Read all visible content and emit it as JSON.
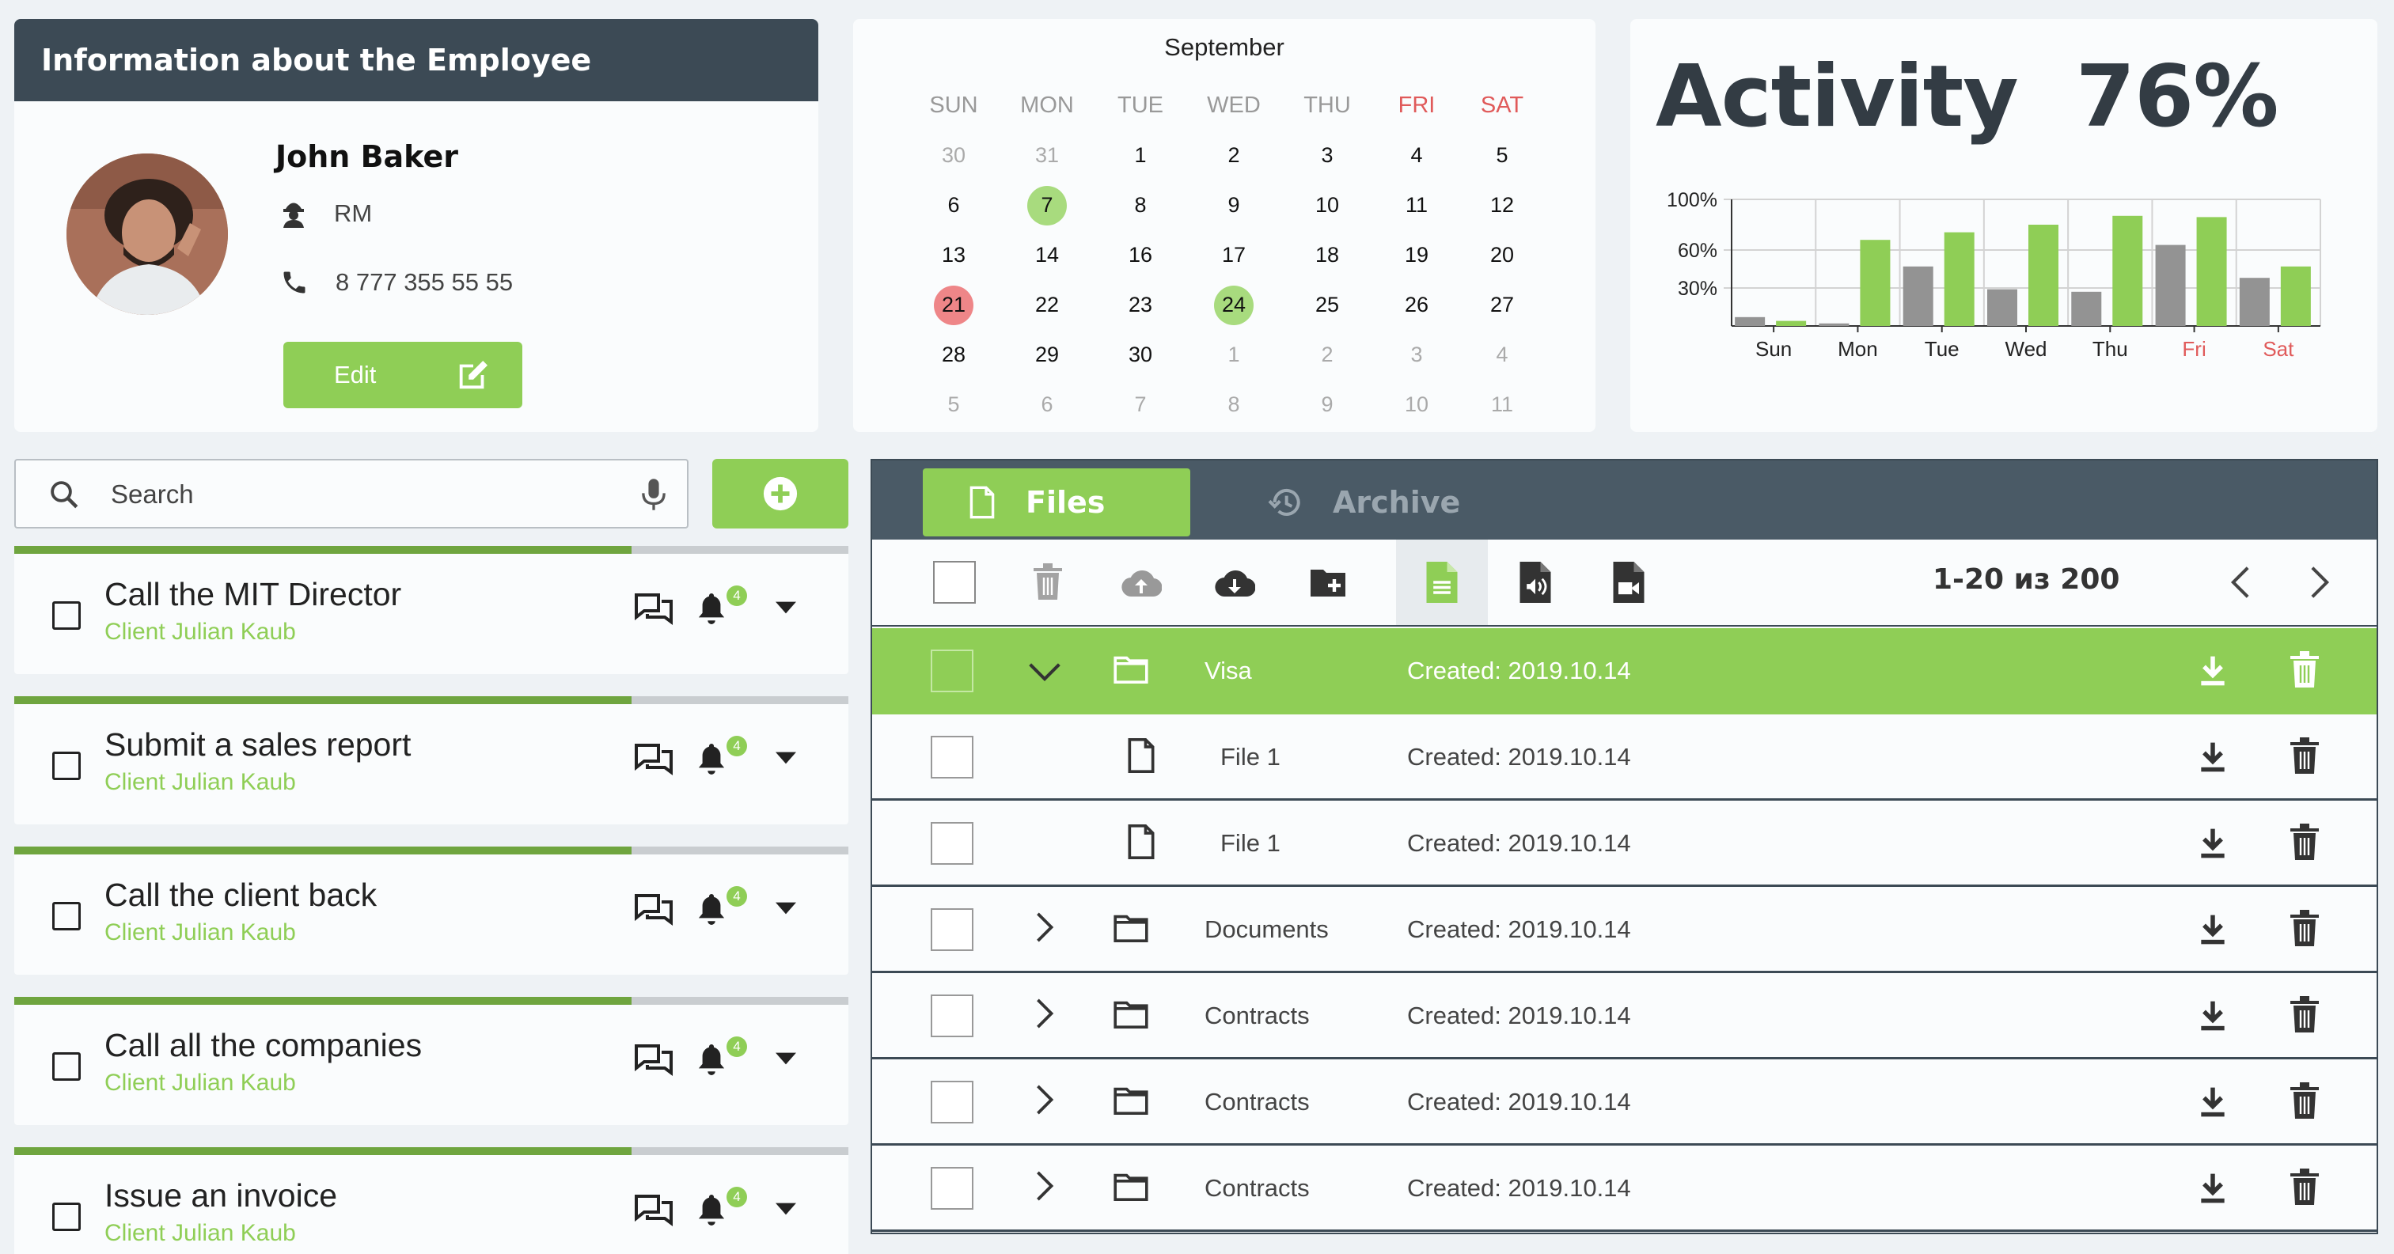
{
  "employee": {
    "header": "Information about the Employee",
    "name": "John Baker",
    "role": "RM",
    "phone": "8 777 355 55 55",
    "edit_label": "Edit"
  },
  "calendar": {
    "month": "September",
    "weekdays": [
      {
        "label": "SUN",
        "weekend": false
      },
      {
        "label": "MON",
        "weekend": false
      },
      {
        "label": "TUE",
        "weekend": false
      },
      {
        "label": "WED",
        "weekend": false
      },
      {
        "label": "THU",
        "weekend": false
      },
      {
        "label": "FRI",
        "weekend": true
      },
      {
        "label": "SAT",
        "weekend": true
      }
    ],
    "weeks": [
      [
        {
          "d": "30",
          "m": true
        },
        {
          "d": "31",
          "m": true
        },
        {
          "d": "1"
        },
        {
          "d": "2"
        },
        {
          "d": "3"
        },
        {
          "d": "4"
        },
        {
          "d": "5"
        }
      ],
      [
        {
          "d": "6"
        },
        {
          "d": "7",
          "hl": "green"
        },
        {
          "d": "8"
        },
        {
          "d": "9"
        },
        {
          "d": "10"
        },
        {
          "d": "11"
        },
        {
          "d": "12"
        }
      ],
      [
        {
          "d": "13"
        },
        {
          "d": "14"
        },
        {
          "d": "16"
        },
        {
          "d": "17"
        },
        {
          "d": "18"
        },
        {
          "d": "19"
        },
        {
          "d": "20"
        }
      ],
      [
        {
          "d": "21",
          "hl": "red"
        },
        {
          "d": "22"
        },
        {
          "d": "23"
        },
        {
          "d": "24",
          "hl": "green"
        },
        {
          "d": "25"
        },
        {
          "d": "26"
        },
        {
          "d": "27"
        }
      ],
      [
        {
          "d": "28"
        },
        {
          "d": "29"
        },
        {
          "d": "30"
        },
        {
          "d": "1",
          "m": true
        },
        {
          "d": "2",
          "m": true
        },
        {
          "d": "3",
          "m": true
        },
        {
          "d": "4",
          "m": true
        }
      ],
      [
        {
          "d": "5",
          "m": true
        },
        {
          "d": "6",
          "m": true
        },
        {
          "d": "7",
          "m": true
        },
        {
          "d": "8",
          "m": true
        },
        {
          "d": "9",
          "m": true
        },
        {
          "d": "10",
          "m": true
        },
        {
          "d": "11",
          "m": true
        }
      ]
    ]
  },
  "activity": {
    "title": "Activity  76%"
  },
  "chart_data": {
    "type": "bar",
    "categories": [
      "Sun",
      "Mon",
      "Tue",
      "Wed",
      "Thu",
      "Fri",
      "Sat"
    ],
    "highlight_categories": [
      "Fri",
      "Sat"
    ],
    "highlight_color": "#e05a5a",
    "y_ticks": [
      "100%",
      "60%",
      "30%"
    ],
    "y_tick_values": [
      100,
      60,
      30
    ],
    "ylim": [
      0,
      100
    ],
    "grid": true,
    "series": [
      {
        "color": "#939393",
        "values": [
          7,
          2,
          47,
          29,
          27,
          64,
          38
        ]
      },
      {
        "color": "#8fce56",
        "values": [
          4,
          68,
          74,
          80,
          87,
          86,
          47
        ]
      }
    ]
  },
  "search": {
    "placeholder": "Search"
  },
  "tasks": [
    {
      "title": "Call the MIT Director",
      "client": "Client Julian Kaub",
      "badge": "4",
      "progress": 0.74
    },
    {
      "title": "Submit a sales report",
      "client": "Client Julian Kaub",
      "badge": "4",
      "progress": 0.74
    },
    {
      "title": "Call the client back",
      "client": "Client Julian Kaub",
      "badge": "4",
      "progress": 0.74
    },
    {
      "title": "Call all the companies",
      "client": "Client Julian Kaub",
      "badge": "4",
      "progress": 0.74
    },
    {
      "title": "Issue an invoice",
      "client": "Client Julian Kaub",
      "badge": "4",
      "progress": 0.74
    }
  ],
  "files": {
    "tab_files": "Files",
    "tab_archive": "Archive",
    "pager": "1-20 из 200",
    "rows": [
      {
        "kind": "folder",
        "name": "Visa",
        "date": "Created: 2019.10.14",
        "expanded": true,
        "selected": true
      },
      {
        "kind": "file",
        "name": "File 1",
        "date": "Created: 2019.10.14"
      },
      {
        "kind": "file",
        "name": "File 1",
        "date": "Created: 2019.10.14"
      },
      {
        "kind": "folder",
        "name": "Documents",
        "date": "Created: 2019.10.14"
      },
      {
        "kind": "folder",
        "name": "Contracts",
        "date": "Created: 2019.10.14"
      },
      {
        "kind": "folder",
        "name": "Contracts",
        "date": "Created: 2019.10.14"
      },
      {
        "kind": "folder",
        "name": "Contracts",
        "date": "Created: 2019.10.14"
      }
    ]
  },
  "colors": {
    "accent": "#8fce56",
    "dark": "#3c4a55",
    "progress": "#6fa53f"
  }
}
